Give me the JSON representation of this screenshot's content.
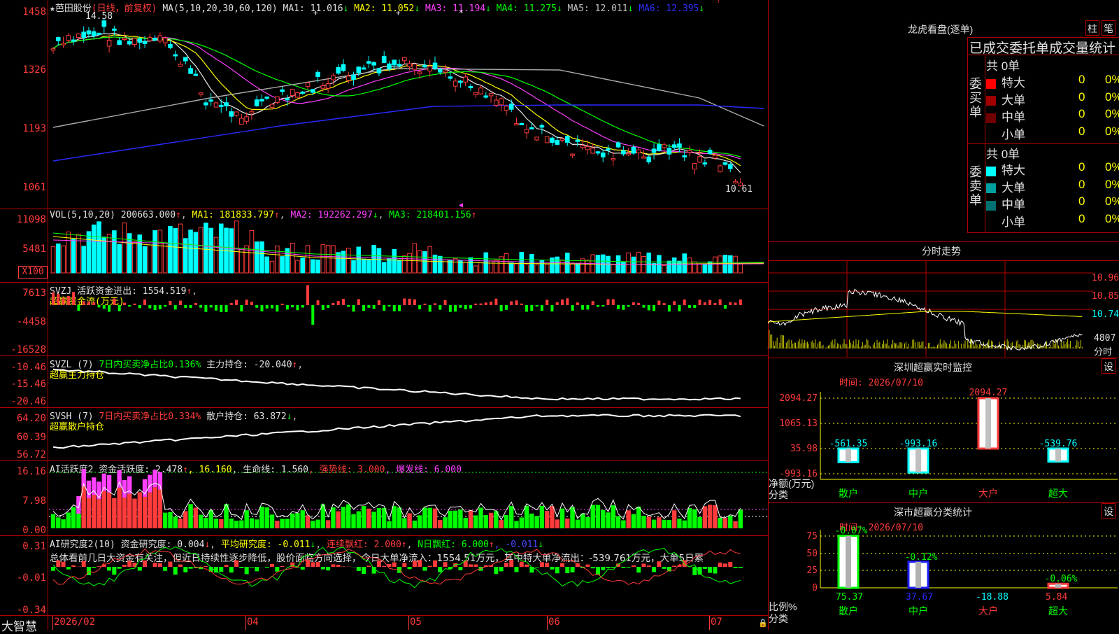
{
  "stock": {
    "star": "★",
    "name": "芭田股份",
    "mode": "(日线，前复权)",
    "ma_label": "MA(5,10,20,30,60,120)",
    "ma": [
      {
        "label": "MA1:",
        "value": "11.016",
        "arrow": "↓",
        "color": "#e0e0e0"
      },
      {
        "label": "MA2:",
        "value": "11.052",
        "arrow": "↓",
        "color": "#ffff00"
      },
      {
        "label": "MA3:",
        "value": "11.194",
        "arrow": "↓",
        "color": "#ff40ff"
      },
      {
        "label": "MA4:",
        "value": "11.275",
        "arrow": "↓",
        "color": "#00ff00"
      },
      {
        "label": "MA5:",
        "value": "12.011",
        "arrow": "↓",
        "color": "#c0c0c0"
      },
      {
        "label": "MA6:",
        "value": "12.395",
        "arrow": "↓",
        "color": "#3030ff"
      }
    ],
    "high_mark": "14.58",
    "low_mark": "10.61",
    "y_labels": [
      "1458",
      "1326",
      "1193",
      "1061"
    ]
  },
  "vol": {
    "title": "VOL(5,10,20)",
    "value": "200663.000",
    "ma1": "MA1: 181833.797",
    "ma2": "MA2: 192262.297",
    "ma3": "MA3: 218401.156",
    "y_labels": [
      "11098",
      "5481"
    ],
    "unit": "X100"
  },
  "svzj": {
    "title": "SVZJ  活跃资金进出: 1554.519",
    "sub": "超赢资金流(万元)",
    "y_labels": [
      "7613",
      "-4458",
      "-16528"
    ]
  },
  "svzl": {
    "title": "SVZL (7) ",
    "pct": "7日内买卖净占比0.136%",
    "hold": " 主力持仓: -20.040",
    "sub": "超赢主力持仓",
    "y_labels": [
      "-10.46",
      "-15.46",
      "-20.46"
    ]
  },
  "svsh": {
    "title": "SVSH (7) ",
    "pct": "7日内买卖净占比0.334%",
    "hold": " 散户持仓: 63.872",
    "sub": "超赢散户持仓",
    "y_labels": [
      "64.20",
      "60.39",
      "56.72"
    ]
  },
  "ai1": {
    "title": "AI活跃度2 资金活跃度: 2.478",
    "v2": ", 16.160",
    "v3": ", 生命线: 1.560",
    "v4": ", 强势线: 3.000",
    "v5": ", 爆发线: 6.000",
    "y_labels": [
      "16.16",
      "7.98",
      "0.00"
    ]
  },
  "ai2": {
    "title": "AI研究度2(10) 资金研究度: 0.004",
    "avg": " 平均研究度: -0.011",
    "red": " 连续飘红: 2.000",
    "nred": " N日飘红: 6.000",
    "last": ", -0.011",
    "comment": "总体看前几日大资金有关注，但近日持续性逐步降低，股价面临方向选择，今日大单净流入：1554.51万元，其中特大单净流出：-539.761万元，大单5日累",
    "y_labels": [
      "0.31",
      "-0.01",
      "-0.34"
    ]
  },
  "xaxis": {
    "brand": "大智慧",
    "labels": [
      "2026/02",
      "04",
      "05",
      "06",
      "07"
    ]
  },
  "dragon": {
    "title": "龙虎看盘(逐单)",
    "btn1": "柱",
    "btn2": "笔",
    "header": "已成交委托单成交量统计",
    "buy_label": "委买单",
    "sell_label": "委卖单",
    "buy_total": "共 0单",
    "sell_total": "共 0单",
    "buy_rows": [
      {
        "name": "特大",
        "count": "0",
        "pct": "0%",
        "color": "#ff0000"
      },
      {
        "name": "大单",
        "count": "0",
        "pct": "0%",
        "color": "#a00000"
      },
      {
        "name": "中单",
        "count": "0",
        "pct": "0%",
        "color": "#700000"
      },
      {
        "name": "小单",
        "count": "0",
        "pct": "0%",
        "color": ""
      }
    ],
    "sell_rows": [
      {
        "name": "特大",
        "count": "0",
        "pct": "0%",
        "color": "#00ffff"
      },
      {
        "name": "大单",
        "count": "0",
        "pct": "0%",
        "color": "#00a0a0"
      },
      {
        "name": "中单",
        "count": "0",
        "pct": "0%",
        "color": "#007070"
      },
      {
        "name": "小单",
        "count": "0",
        "pct": "0%",
        "color": ""
      }
    ]
  },
  "intraday": {
    "title": "分时走势",
    "y_labels": [
      "10.96",
      "10.85",
      "10.74",
      "4807"
    ],
    "unit": "分时"
  },
  "monitor": {
    "title": "深圳超赢实时监控",
    "btn": "设",
    "time": "时间: 2026/07/10",
    "y_labels": [
      "2094.27",
      "1065.13",
      "35.98",
      "-993.16"
    ],
    "axis_title_1": "净额(万元)",
    "axis_title_2": "分类",
    "categories": [
      "散户",
      "中户",
      "大户",
      "超大"
    ],
    "values": [
      -561.35,
      -993.16,
      2094.27,
      -539.76
    ],
    "value_labels": [
      "-561.35",
      "-993.16",
      "2094.27",
      "-539.76"
    ]
  },
  "classify": {
    "title": "深市超赢分类统计",
    "btn": "设",
    "time": "时间: 2026/07/10",
    "y_labels": [
      "75",
      "50",
      "25",
      "0"
    ],
    "axis_title_1": "比例%",
    "axis_title_2": "分类",
    "categories": [
      "散户",
      "中户",
      "大户",
      "超大"
    ],
    "values": [
      75.37,
      37.67,
      -18.88,
      5.84
    ],
    "value_labels": [
      "75.37",
      "37.67",
      "-18.88",
      "5.84"
    ],
    "change_labels": [
      "-0.07%",
      "-0.12%",
      "",
      "-0.06%"
    ]
  }
}
